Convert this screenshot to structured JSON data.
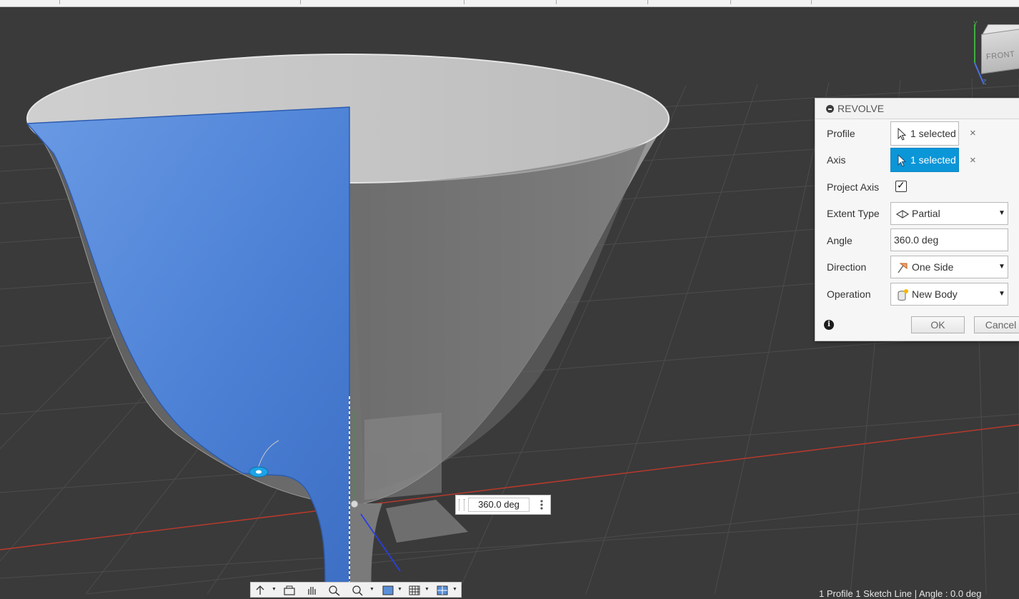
{
  "viewcube": {
    "face_label": "FRONT",
    "axis_y": "Y",
    "axis_z": "Z"
  },
  "revolve": {
    "title": "REVOLVE",
    "profile": {
      "label": "Profile",
      "value": "1 selected",
      "clear": "×"
    },
    "axis": {
      "label": "Axis",
      "value": "1 selected",
      "clear": "×"
    },
    "project_axis": {
      "label": "Project Axis",
      "checked": true,
      "check_glyph": "✓"
    },
    "extent_type": {
      "label": "Extent Type",
      "value": "Partial",
      "icon": "partial-extent-icon"
    },
    "angle": {
      "label": "Angle",
      "value": "360.0 deg"
    },
    "direction": {
      "label": "Direction",
      "value": "One Side",
      "icon": "one-side-icon"
    },
    "operation": {
      "label": "Operation",
      "value": "New Body",
      "icon": "new-body-icon"
    },
    "ok_label": "OK",
    "cancel_label": "Cancel",
    "info_glyph": "i"
  },
  "canvas": {
    "angle_manipulator_value": "360.0 deg"
  },
  "status_bar": {
    "text": "1 Profile 1 Sketch Line | Angle : 0.0 deg"
  },
  "colors": {
    "viewport_bg": "#3a3a3a",
    "selection_blue": "#4a7fd4",
    "accent": "#0b96d8",
    "axis_red": "#c0392b",
    "axis_green": "#3a9a3a",
    "axis_blue": "#2a3fe0"
  }
}
